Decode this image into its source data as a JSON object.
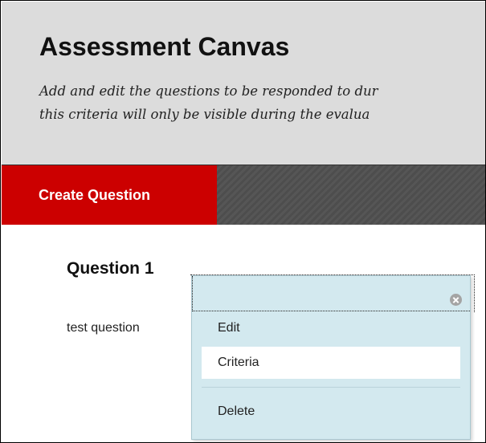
{
  "header": {
    "title": "Assessment Canvas",
    "description_line1": "Add and edit the questions to be responded to dur",
    "description_line2": "this criteria will only be visible during the evalua"
  },
  "toolbar": {
    "create_question_label": "Create Question"
  },
  "question": {
    "heading": "Question 1",
    "text": "test question"
  },
  "context_menu": {
    "close_icon": "close-circle-icon",
    "items": [
      {
        "label": "Edit"
      },
      {
        "label": "Criteria"
      },
      {
        "label": "Delete"
      }
    ]
  },
  "colors": {
    "header_bg": "#dcdcdc",
    "accent_red": "#cc0000",
    "toolbar_dark": "#4d4d4d",
    "menu_bg": "#d3e9ef"
  }
}
